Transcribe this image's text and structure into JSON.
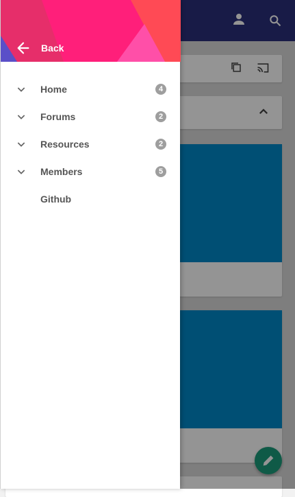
{
  "drawer": {
    "back_label": "Back",
    "items": [
      {
        "label": "Home",
        "badge": "4",
        "has_children": true
      },
      {
        "label": "Forums",
        "badge": "2",
        "has_children": true
      },
      {
        "label": "Resources",
        "badge": "2",
        "has_children": true
      },
      {
        "label": "Members",
        "badge": "5",
        "has_children": true
      },
      {
        "label": "Github",
        "badge": null,
        "has_children": false
      }
    ]
  },
  "icons": {
    "back": "arrow-left-icon",
    "expand": "chevron-down-icon",
    "account": "account-icon",
    "search": "search-icon",
    "copy": "copy-icon",
    "cast": "cast-icon",
    "collapse": "chevron-up-icon",
    "compose": "pencil-icon"
  },
  "colors": {
    "topbar": "#2a2f7a",
    "drawer_header": "#ff1f7a",
    "media": "#0088c8",
    "fab": "#1a9b7a",
    "badge": "#9e9e9e",
    "menu_text": "#555555"
  }
}
